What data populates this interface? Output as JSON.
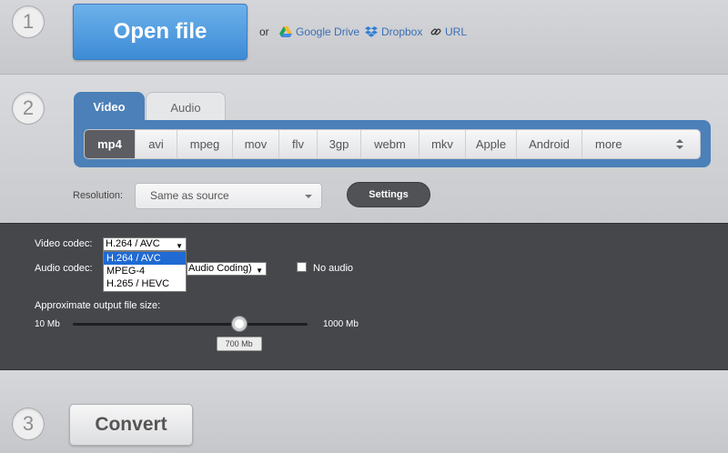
{
  "steps": {
    "one": "1",
    "two": "2",
    "three": "3"
  },
  "open": {
    "button": "Open file",
    "or": "or",
    "sources": [
      {
        "label": "Google Drive",
        "icon": "google-drive-icon"
      },
      {
        "label": "Dropbox",
        "icon": "dropbox-icon"
      },
      {
        "label": "URL",
        "icon": "link-icon"
      }
    ]
  },
  "tabs": {
    "video": "Video",
    "audio": "Audio",
    "active": "Video"
  },
  "formats": {
    "items": [
      "mp4",
      "avi",
      "mpeg",
      "mov",
      "flv",
      "3gp",
      "webm",
      "mkv",
      "Apple",
      "Android",
      "more"
    ],
    "selected": "mp4"
  },
  "resolution": {
    "label": "Resolution:",
    "value": "Same as source"
  },
  "settings_button": "Settings",
  "settings": {
    "video_codec_label": "Video codec:",
    "video_codec_value": "H.264 / AVC",
    "video_codec_options": [
      "H.264 / AVC",
      "MPEG-4",
      "H.265 / HEVC"
    ],
    "audio_codec_label": "Audio codec:",
    "audio_codec_value_visible": "Audio Coding)",
    "no_audio_label": "No audio",
    "no_audio_checked": false,
    "size_label": "Approximate output file size:",
    "size_min": "10 Mb",
    "size_max": "1000 Mb",
    "size_value": "700 Mb",
    "slider_fraction": 0.7
  },
  "convert_button": "Convert",
  "colors": {
    "accent": "#4b80b8",
    "primary_button": "#4a94dc",
    "panel": "#45474b"
  }
}
